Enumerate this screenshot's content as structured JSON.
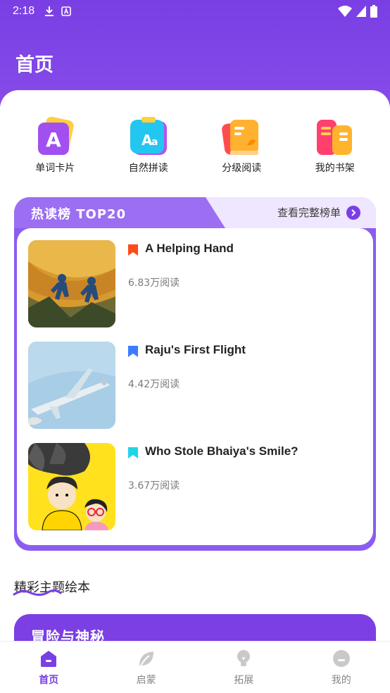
{
  "status": {
    "time": "2:18"
  },
  "header": {
    "title": "首页"
  },
  "quick": [
    {
      "label": "单词卡片",
      "icon": "letter-a-icon"
    },
    {
      "label": "自然拼读",
      "icon": "phonics-icon"
    },
    {
      "label": "分级阅读",
      "icon": "graded-reading-icon"
    },
    {
      "label": "我的书架",
      "icon": "bookshelf-icon"
    }
  ],
  "ranking": {
    "title": "热读榜 TOP20",
    "more_label": "查看完整榜单",
    "books": [
      {
        "title": "A Helping Hand",
        "reads": "6.83万阅读",
        "flag_color": "#ff4a1a"
      },
      {
        "title": "Raju's First Flight",
        "reads": "4.42万阅读",
        "flag_color": "#3d7bff"
      },
      {
        "title": "Who Stole Bhaiya's Smile?",
        "reads": "3.67万阅读",
        "flag_color": "#21d4e8"
      }
    ]
  },
  "section": {
    "title": "精彩主题绘本"
  },
  "banner": {
    "title": "冒险与神秘"
  },
  "tabs": [
    {
      "label": "首页",
      "icon": "home-icon",
      "active": true
    },
    {
      "label": "启蒙",
      "icon": "leaf-icon",
      "active": false
    },
    {
      "label": "拓展",
      "icon": "bulb-icon",
      "active": false
    },
    {
      "label": "我的",
      "icon": "profile-icon",
      "active": false
    }
  ],
  "colors": {
    "primary": "#7a3fe4",
    "primary_light": "#efe6ff"
  }
}
